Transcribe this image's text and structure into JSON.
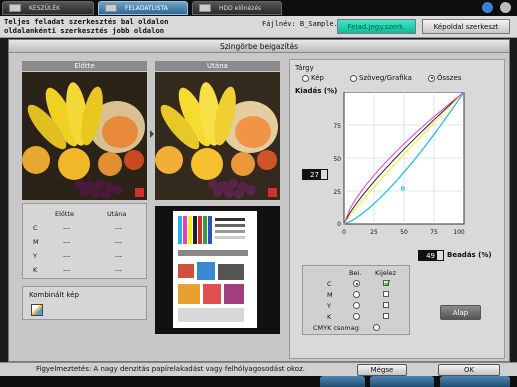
{
  "tabs": [
    {
      "label": "KÉSZÜLÉK"
    },
    {
      "label": "FELADATLISTA"
    },
    {
      "label": "HDD előnézés"
    }
  ],
  "header": {
    "text_line1": "Teljes feladat szerkesztés bal oldalon",
    "text_line2": "oldalankénti szerkesztés jobb oldalon",
    "filename_label": "Fájlnév: B_Sample.pdf",
    "btn_job_edit": "Felad.jegy.szerk.",
    "btn_image_edit": "Képoldal szerkeszt"
  },
  "dialog": {
    "title": "Szingörbe beigazítás",
    "before_label": "Előtte",
    "after_label": "Utána",
    "table": {
      "headers": [
        "Előtte",
        "Utána"
      ],
      "rows": [
        {
          "ch": "C",
          "before": "---",
          "after": "---"
        },
        {
          "ch": "M",
          "before": "---",
          "after": "---"
        },
        {
          "ch": "Y",
          "before": "---",
          "after": "---"
        },
        {
          "ch": "K",
          "before": "---",
          "after": "---"
        }
      ]
    },
    "combined_label": "Kombinált kép",
    "target": {
      "label": "Tárgy",
      "options": [
        "Kép",
        "Szöveg/Grafika",
        "Összes"
      ],
      "selected": "Összes"
    },
    "output_label": "Kiadás (%)",
    "input_label": "Beadás (%)",
    "output_value": "27",
    "input_value": "49",
    "ticks_y": [
      "100",
      "75",
      "50",
      "25",
      "0"
    ],
    "ticks_x": [
      "0",
      "25",
      "50",
      "75",
      "100"
    ],
    "channel_table": {
      "col_on": "Bei.",
      "col_display": "Kijelez",
      "rows": [
        {
          "ch": "C",
          "on": true,
          "display": true
        },
        {
          "ch": "M",
          "on": false,
          "display": false
        },
        {
          "ch": "Y",
          "on": false,
          "display": false
        },
        {
          "ch": "K",
          "on": false,
          "display": false
        }
      ],
      "cmyk_label": "CMYK csomag"
    },
    "reset_button": "Alap"
  },
  "footer": {
    "warning": "Figyelmeztetés: A nagy denzitás papírelakadást vagy felhólyagosodást okoz.",
    "cancel": "Mégse",
    "ok": "OK"
  },
  "colors": {
    "curve_cyan": "#1fb6e8",
    "curve_magenta": "#e83cc8",
    "curve_yellow": "#f0f020",
    "curve_black": "#222222",
    "accent_green": "#12b89a"
  }
}
